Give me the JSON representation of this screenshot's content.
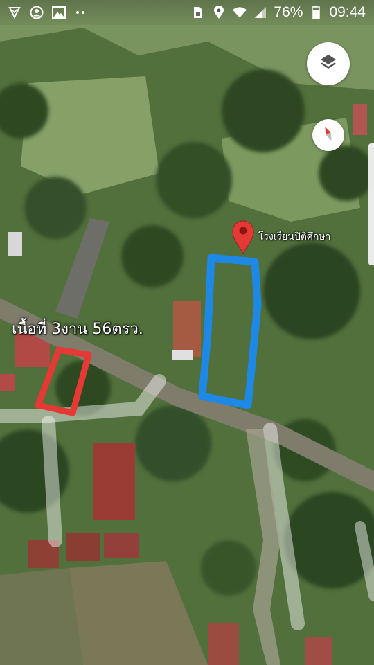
{
  "status_bar": {
    "left_icons": [
      "shield-check-icon",
      "account-circle-icon",
      "gallery-icon",
      "more-dots-icon"
    ],
    "right_icons": [
      "sim-icon",
      "location-pin-icon",
      "wifi-icon",
      "signal-icon"
    ],
    "battery": "76%",
    "time": "09:44"
  },
  "map": {
    "type": "satellite",
    "place_pin_label": "โรงเรียนปิติศึกษา",
    "annotation_text": "เนื้อที่ 3งาน 56ตรว.",
    "colors": {
      "pin": "#e53935",
      "blue_outline": "#1e88e5",
      "red_outline": "#e53935"
    }
  },
  "controls": {
    "layers_button": "layers-icon",
    "compass_button": "compass-icon"
  }
}
